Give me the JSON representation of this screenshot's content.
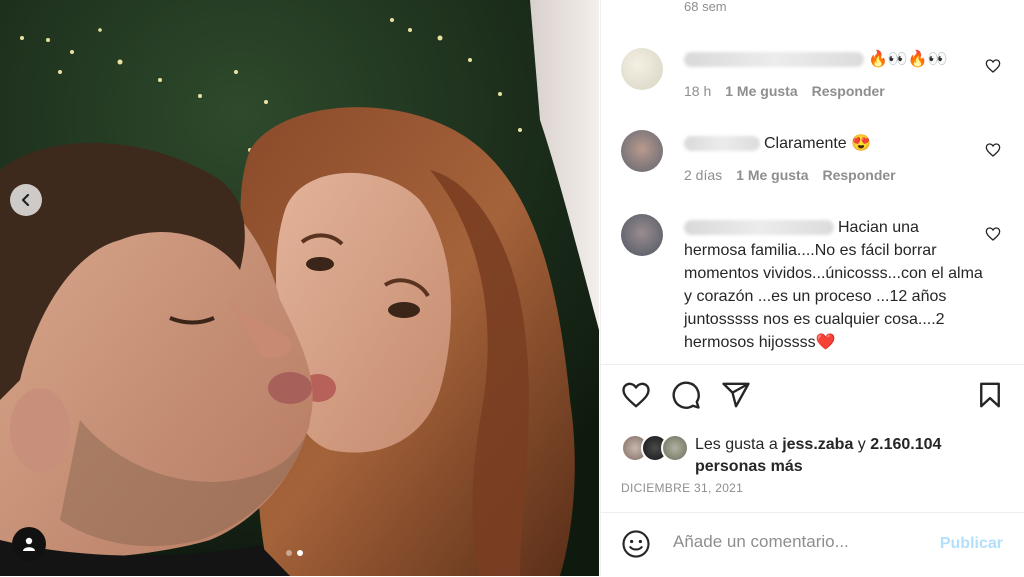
{
  "post": {
    "image_alt": "",
    "carousel": {
      "total": 2,
      "active": 2
    }
  },
  "comments_panel": {
    "top_timestamp": "68 sem",
    "comments": [
      {
        "text": "🔥👀🔥👀",
        "time": "18 h",
        "likes": "1 Me gusta",
        "reply": "Responder"
      },
      {
        "text": "Claramente 😍",
        "time": "2 días",
        "likes": "1 Me gusta",
        "reply": "Responder"
      },
      {
        "text": "Hacian una hermosa familia....No es fácil borrar momentos vividos...únicosss...con el alma y corazón ...es un proceso ...12 años juntosssss nos es cualquier cosa....2 hermosos hijossss❤️"
      }
    ]
  },
  "likes": {
    "prefix": "Les gusta a",
    "user": "jess.zaba",
    "connector": "y",
    "count": "2.160.104",
    "suffix": "personas más"
  },
  "post_date": "DICIEMBRE 31, 2021",
  "add_comment": {
    "placeholder": "Añade un comentario...",
    "publish_label": "Publicar"
  },
  "icons": {
    "like": "heart-icon",
    "comment": "comment-icon",
    "share": "paper-plane-icon",
    "save": "bookmark-icon",
    "emoji": "smiley-icon",
    "prev": "chevron-left-icon",
    "tag": "user-tag-icon"
  },
  "colors": {
    "publish_disabled": "#b2dffc",
    "secondary_text": "#8e8e8e",
    "primary_text": "#262626"
  }
}
